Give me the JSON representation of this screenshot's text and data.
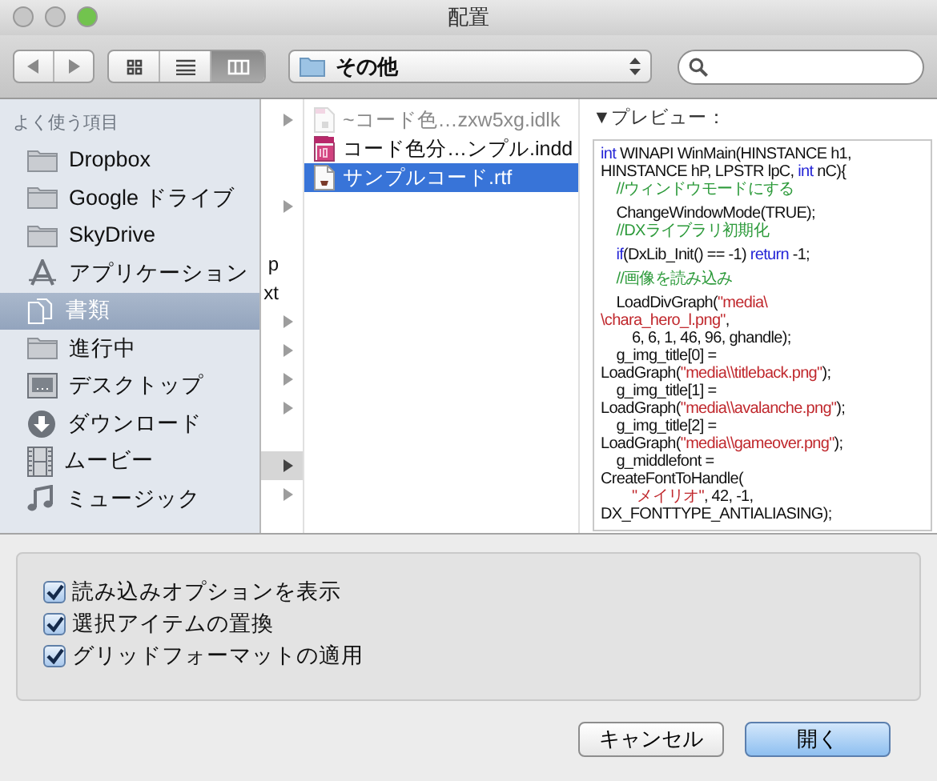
{
  "window": {
    "title": "配置",
    "controls": [
      {
        "color": "#c6c6c6"
      },
      {
        "color": "#c6c6c6"
      },
      {
        "color": "#72c34e"
      }
    ]
  },
  "toolbar": {
    "views": [
      {
        "kind": "icons",
        "selected": false
      },
      {
        "kind": "list",
        "selected": false
      },
      {
        "kind": "columns",
        "selected": true
      }
    ],
    "location": "その他"
  },
  "sidebar": {
    "heading": "よく使う項目",
    "items": [
      {
        "label": "Dropbox",
        "kind": "folder",
        "selected": false
      },
      {
        "label": "Google ドライブ",
        "kind": "folder",
        "selected": false
      },
      {
        "label": "SkyDrive",
        "kind": "folder",
        "selected": false
      },
      {
        "label": "アプリケーション",
        "kind": "apps",
        "selected": false
      },
      {
        "label": "書類",
        "kind": "documents",
        "selected": true
      },
      {
        "label": "進行中",
        "kind": "folder",
        "selected": false
      },
      {
        "label": "デスクトップ",
        "kind": "desktop",
        "selected": false
      },
      {
        "label": "ダウンロード",
        "kind": "download",
        "selected": false
      },
      {
        "label": "ムービー",
        "kind": "movie",
        "selected": false
      },
      {
        "label": "ミュージック",
        "kind": "music",
        "selected": false
      }
    ]
  },
  "parent_column": [
    {
      "folder": true,
      "selected": false
    },
    {
      "folder": false,
      "selected": false
    },
    {
      "folder": false,
      "selected": false
    },
    {
      "folder": true,
      "selected": false
    },
    {
      "folder": false,
      "selected": false
    },
    {
      "text": "p",
      "folder": false,
      "selected": false
    },
    {
      "text": "xt",
      "folder": false,
      "selected": false
    },
    {
      "folder": true,
      "selected": false
    },
    {
      "folder": true,
      "selected": false
    },
    {
      "folder": true,
      "selected": false
    },
    {
      "folder": true,
      "selected": false
    },
    {
      "folder": false,
      "selected": false
    },
    {
      "folder": true,
      "selected": true
    },
    {
      "folder": true,
      "selected": false
    }
  ],
  "files": [
    {
      "name": "~コード色…zxw5xg.idlk",
      "kind": "lock",
      "dimmed": true,
      "selected": false
    },
    {
      "name": "コード色分…ンプル.indd",
      "kind": "indesign",
      "dimmed": false,
      "selected": false
    },
    {
      "name": "サンプルコード.rtf",
      "kind": "rtf",
      "dimmed": false,
      "selected": true
    }
  ],
  "preview": {
    "heading": "▼プレビュー：",
    "lines": [
      {
        "tokens": [
          {
            "t": "int",
            "kind": "keyword"
          },
          {
            "t": " WINAPI WinMain(HINSTANCE h1,",
            "kind": "plain"
          }
        ]
      },
      {
        "tokens": [
          {
            "t": "HINSTANCE hP, LPSTR lpC, ",
            "kind": "plain"
          },
          {
            "t": "int",
            "kind": "keyword"
          },
          {
            "t": " nC){",
            "kind": "plain"
          }
        ]
      },
      {
        "tokens": [
          {
            "t": "\t//ウィンドウモードにする",
            "kind": "comment"
          }
        ]
      },
      {
        "space_before": true,
        "tokens": [
          {
            "t": "\tChangeWindowMode(TRUE);",
            "kind": "plain"
          }
        ]
      },
      {
        "tokens": [
          {
            "t": "\t//DXライブラリ初期化",
            "kind": "comment"
          }
        ]
      },
      {
        "space_before": true,
        "tokens": [
          {
            "t": "\tif",
            "kind": "keyword"
          },
          {
            "t": "(DxLib_Init() == -1) ",
            "kind": "plain"
          },
          {
            "t": "return",
            "kind": "keyword"
          },
          {
            "t": " -1;",
            "kind": "plain"
          }
        ]
      },
      {
        "space_before": true,
        "tokens": [
          {
            "t": "\t//画像を読み込み",
            "kind": "comment"
          }
        ]
      },
      {
        "space_before": true,
        "tokens": [
          {
            "t": "\tLoadDivGraph(",
            "kind": "plain"
          },
          {
            "t": "\"media\\",
            "kind": "string"
          }
        ]
      },
      {
        "tokens": [
          {
            "t": "\\chara_hero_l.png\"",
            "kind": "string"
          },
          {
            "t": ",",
            "kind": "plain"
          }
        ]
      },
      {
        "tokens": [
          {
            "t": "\t\t6, 6, 1, 46, 96, ghandle);",
            "kind": "plain"
          }
        ]
      },
      {
        "tokens": [
          {
            "t": "\tg_img_title[0] =",
            "kind": "plain"
          }
        ]
      },
      {
        "tokens": [
          {
            "t": "LoadGraph(",
            "kind": "plain"
          },
          {
            "t": "\"media\\\\titleback.png\"",
            "kind": "string"
          },
          {
            "t": ");",
            "kind": "plain"
          }
        ]
      },
      {
        "tokens": [
          {
            "t": "\tg_img_title[1] =",
            "kind": "plain"
          }
        ]
      },
      {
        "tokens": [
          {
            "t": "LoadGraph(",
            "kind": "plain"
          },
          {
            "t": "\"media\\\\avalanche.png\"",
            "kind": "string"
          },
          {
            "t": ");",
            "kind": "plain"
          }
        ]
      },
      {
        "tokens": [
          {
            "t": "\tg_img_title[2] =",
            "kind": "plain"
          }
        ]
      },
      {
        "tokens": [
          {
            "t": "LoadGraph(",
            "kind": "plain"
          },
          {
            "t": "\"media\\\\gameover.png\"",
            "kind": "string"
          },
          {
            "t": ");",
            "kind": "plain"
          }
        ]
      },
      {
        "tokens": [
          {
            "t": "\tg_middlefont =",
            "kind": "plain"
          }
        ]
      },
      {
        "tokens": [
          {
            "t": "CreateFontToHandle(",
            "kind": "plain"
          }
        ]
      },
      {
        "tokens": [
          {
            "t": "\t\t\"メイリオ\"",
            "kind": "string"
          },
          {
            "t": ", 42, -1,",
            "kind": "plain"
          }
        ]
      },
      {
        "tokens": [
          {
            "t": "DX_FONTTYPE_ANTIALIASING);",
            "kind": "plain"
          }
        ]
      }
    ]
  },
  "options": [
    {
      "label": "読み込みオプションを表示",
      "checked": true
    },
    {
      "label": "選択アイテムの置換",
      "checked": true
    },
    {
      "label": "グリッドフォーマットの適用",
      "checked": true
    }
  ],
  "buttons": [
    {
      "label": "キャンセル",
      "default": false
    },
    {
      "label": "開く",
      "default": true
    }
  ]
}
